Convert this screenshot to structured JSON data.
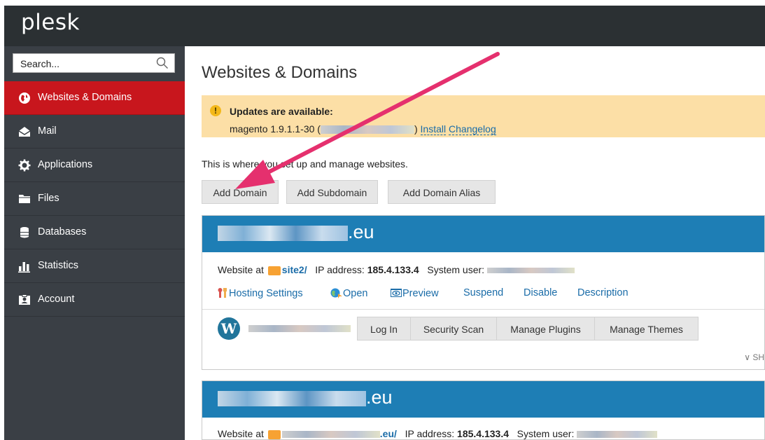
{
  "brand": {
    "logo": "plesk"
  },
  "search": {
    "placeholder": "Search..."
  },
  "sidebar": {
    "items": [
      {
        "label": "Websites & Domains",
        "icon": "globe-icon",
        "active": true
      },
      {
        "label": "Mail",
        "icon": "envelope-icon"
      },
      {
        "label": "Applications",
        "icon": "gear-icon"
      },
      {
        "label": "Files",
        "icon": "folder-icon"
      },
      {
        "label": "Databases",
        "icon": "database-icon"
      },
      {
        "label": "Statistics",
        "icon": "bar-chart-icon"
      },
      {
        "label": "Account",
        "icon": "id-card-icon"
      }
    ]
  },
  "main": {
    "title": "Websites & Domains",
    "alert": {
      "title": "Updates are available:",
      "package": "magento 1.9.1.1-30 (",
      "package_end": ")",
      "install": "Install",
      "changelog": "Changelog"
    },
    "intro": "This is where you set up and manage websites.",
    "buttons": {
      "add_domain": "Add Domain",
      "add_subdomain": "Add Subdomain",
      "add_domain_alias": "Add Domain Alias"
    },
    "domains": [
      {
        "name_suffix": ".eu",
        "website_at": "Website at",
        "folder": "site2/",
        "ip_label": "IP address:",
        "ip": "185.4.133.4",
        "user_label": "System user:",
        "actions": {
          "hosting": "Hosting Settings",
          "open": "Open",
          "preview": "Preview",
          "suspend": "Suspend",
          "disable": "Disable",
          "description": "Description"
        },
        "wp": {
          "login": "Log In",
          "security": "Security Scan",
          "plugins": "Manage Plugins",
          "themes": "Manage Themes"
        },
        "more": "SH"
      },
      {
        "name_suffix": ".eu",
        "website_at": "Website at",
        "folder_suffix": ".eu/",
        "ip_label": "IP address:",
        "ip": "185.4.133.4",
        "user_label": "System user:"
      }
    ]
  },
  "colors": {
    "topbar": "#2b3033",
    "sidebar": "#3a3f45",
    "active": "#c8161d",
    "domain_header": "#1e7eb5",
    "alert": "#fcdfa6",
    "arrow": "#e5306e"
  }
}
